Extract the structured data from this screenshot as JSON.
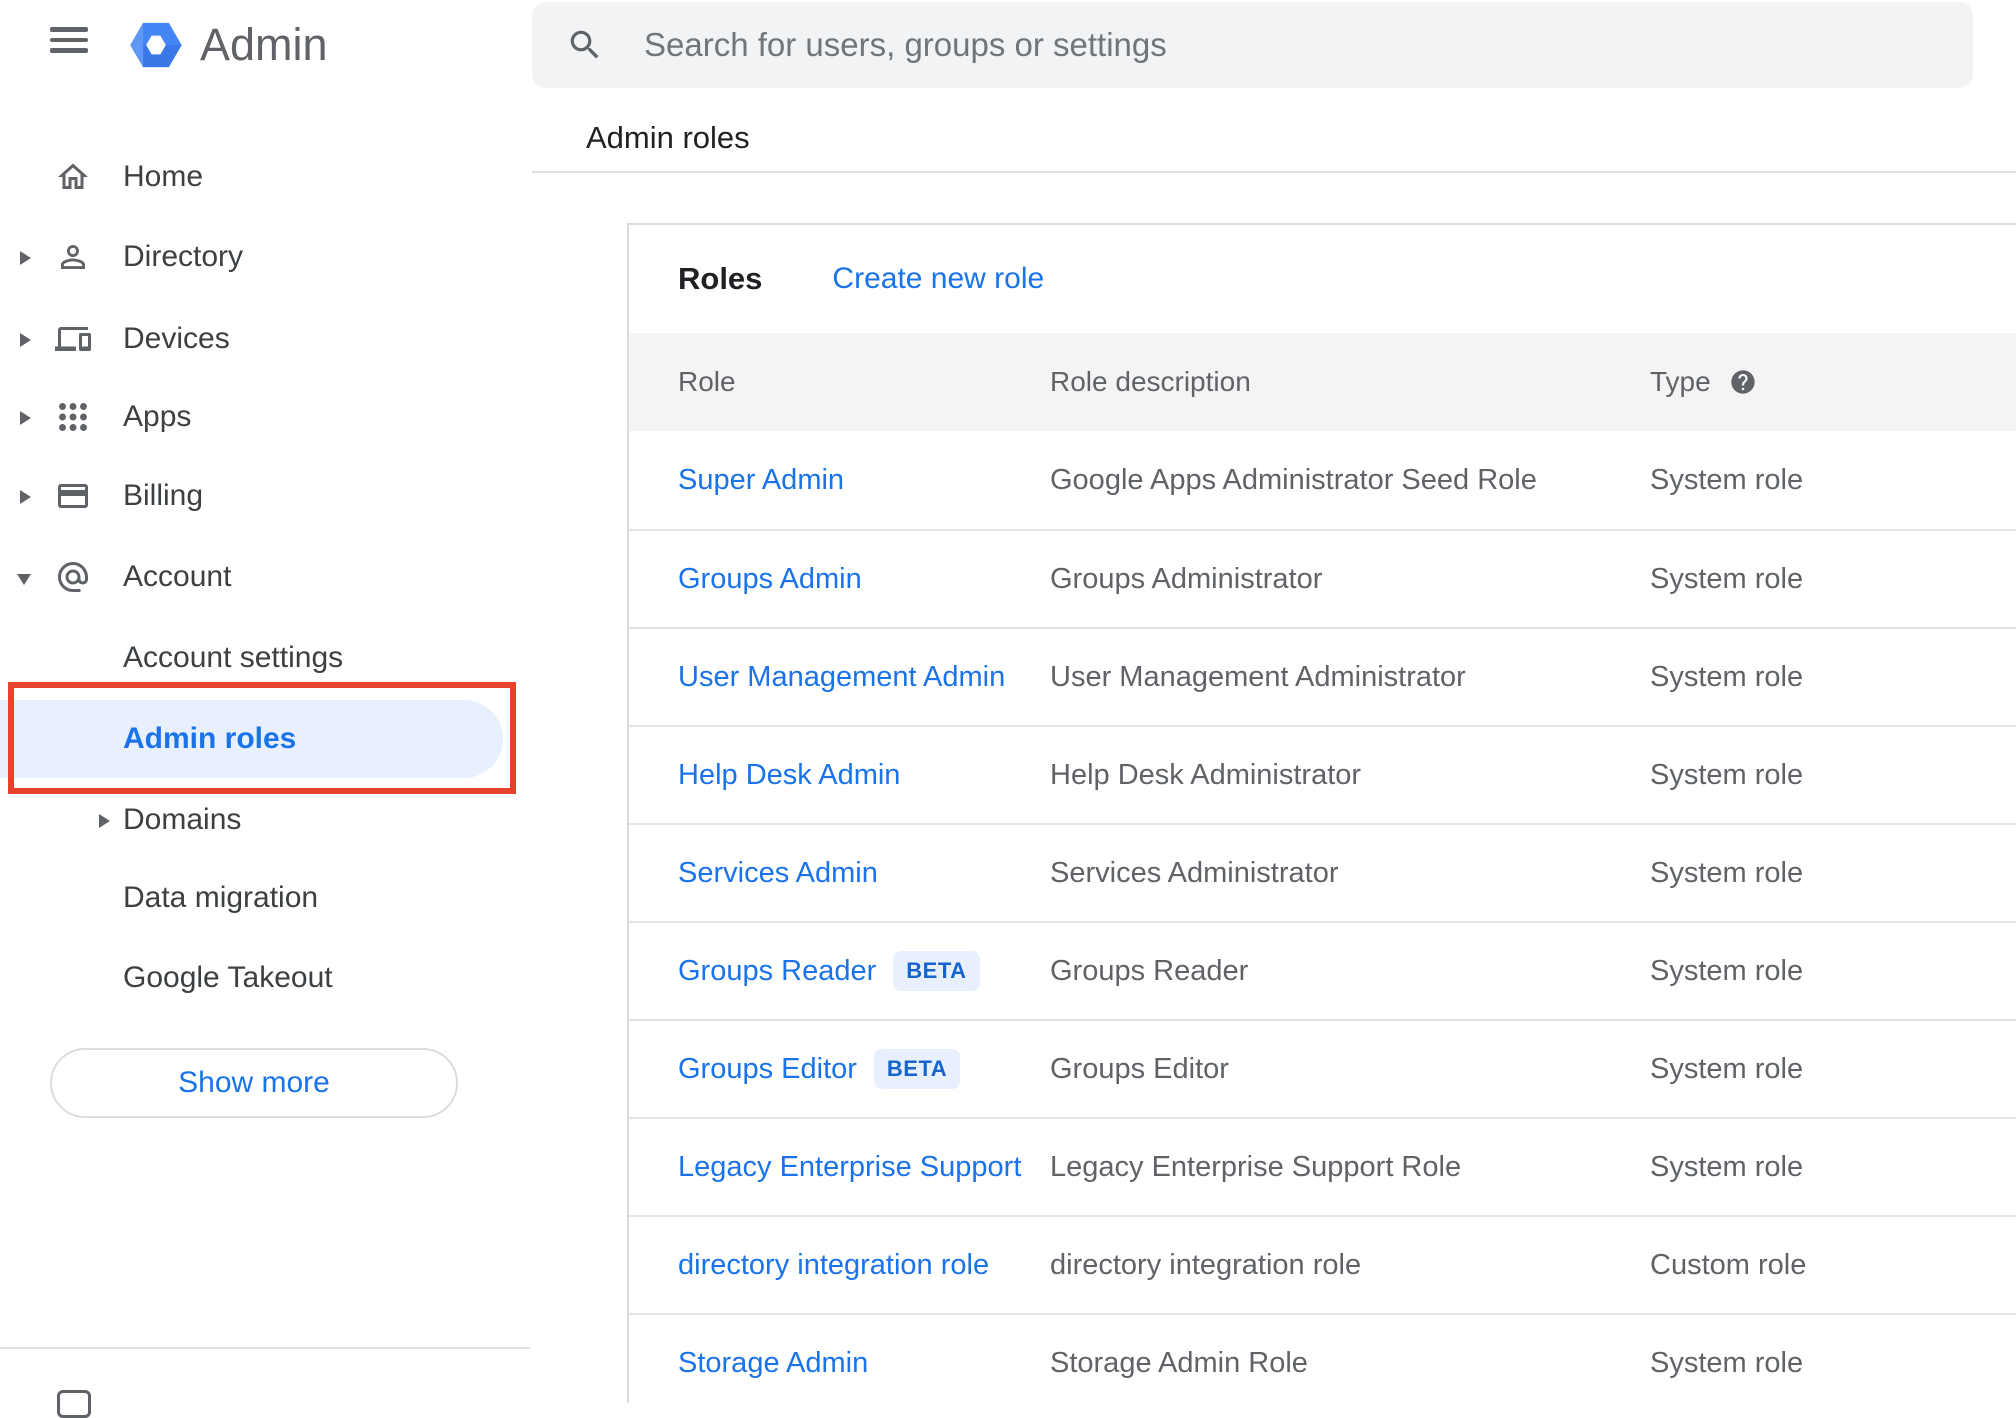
{
  "app": {
    "title": "Admin"
  },
  "search": {
    "placeholder": "Search for users, groups or settings"
  },
  "breadcrumb": "Admin roles",
  "sidebar": {
    "items": [
      {
        "label": "Home"
      },
      {
        "label": "Directory"
      },
      {
        "label": "Devices"
      },
      {
        "label": "Apps"
      },
      {
        "label": "Billing"
      },
      {
        "label": "Account"
      }
    ],
    "sub_items": [
      {
        "label": "Account settings"
      },
      {
        "label": "Admin roles",
        "active": true
      },
      {
        "label": "Domains"
      },
      {
        "label": "Data migration"
      },
      {
        "label": "Google Takeout"
      }
    ],
    "show_more_label": "Show more"
  },
  "main": {
    "card_title": "Roles",
    "create_link": "Create new role",
    "columns": {
      "role": "Role",
      "description": "Role description",
      "type": "Type"
    },
    "beta_label": "BETA",
    "rows": [
      {
        "role": "Super Admin",
        "beta": false,
        "description": "Google Apps Administrator Seed Role",
        "type": "System role"
      },
      {
        "role": "Groups Admin",
        "beta": false,
        "description": "Groups Administrator",
        "type": "System role"
      },
      {
        "role": "User Management Admin",
        "beta": false,
        "description": "User Management Administrator",
        "type": "System role"
      },
      {
        "role": "Help Desk Admin",
        "beta": false,
        "description": "Help Desk Administrator",
        "type": "System role"
      },
      {
        "role": "Services Admin",
        "beta": false,
        "description": "Services Administrator",
        "type": "System role"
      },
      {
        "role": "Groups Reader",
        "beta": true,
        "description": "Groups Reader",
        "type": "System role"
      },
      {
        "role": "Groups Editor",
        "beta": true,
        "description": "Groups Editor",
        "type": "System role"
      },
      {
        "role": "Legacy Enterprise Support",
        "beta": false,
        "description": "Legacy Enterprise Support Role",
        "type": "System role"
      },
      {
        "role": "directory integration role",
        "beta": false,
        "description": "directory integration role",
        "type": "Custom role"
      },
      {
        "role": "Storage Admin",
        "beta": false,
        "description": "Storage Admin Role",
        "type": "System role"
      }
    ]
  },
  "colors": {
    "accent_blue": "#1a73e8",
    "active_item_bg": "#e8f0fe",
    "annotation_red": "#e8412c",
    "table_header_bg": "#f4f4f4",
    "gray_text": "#5f6368",
    "logo_blue": "#4285f4"
  }
}
